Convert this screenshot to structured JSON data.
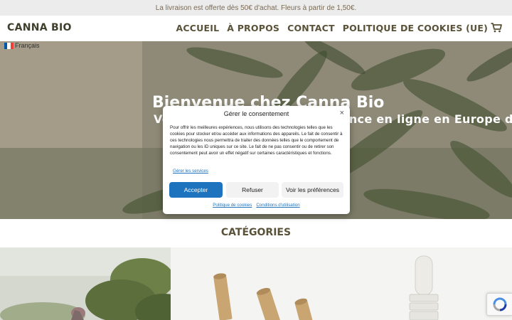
{
  "topbar": {
    "text": "La livraison est offerte dès 50€ d'achat. Fleurs à partir de 1,50€."
  },
  "header": {
    "logo": "CANNA BIO",
    "nav": [
      "ACCUEIL",
      "À PROPOS",
      "CONTACT",
      "POLITIQUE DE COOKIES (UE)"
    ],
    "cart_icon": "cart-icon"
  },
  "language": {
    "label": "Français",
    "flag_colors": [
      "#0055a4",
      "#ffffff",
      "#ef4135"
    ]
  },
  "hero": {
    "title": "Bienvenue chez Canna Bio",
    "subtitle": "Votre boutique CBD de confiance en ligne en Europe depuis",
    "text_color": "#ffffff"
  },
  "consent": {
    "title": "Gérer le consentement",
    "close": "×",
    "body": "Pour offrir les meilleures expériences, nous utilisons des technologies telles que les cookies pour stocker et/ou accéder aux informations des appareils. Le fait de consentir à ces technologies nous permettra de traiter des données telles que le comportement de navigation ou les ID uniques sur ce site. Le fait de ne pas consentir ou de retirer son consentement peut avoir un effet négatif sur certaines caractéristiques et fonctions.",
    "services_link": "Gérer les services",
    "accept": "Accepter",
    "refuse": "Refuser",
    "preferences": "Voir les préférences",
    "footer_links": [
      "Politique de cookies",
      "Conditions d'utilisation"
    ],
    "accent_color": "#1e73be"
  },
  "categories": {
    "title": "CATÉGORIES"
  },
  "brand_color": "#5a5238"
}
